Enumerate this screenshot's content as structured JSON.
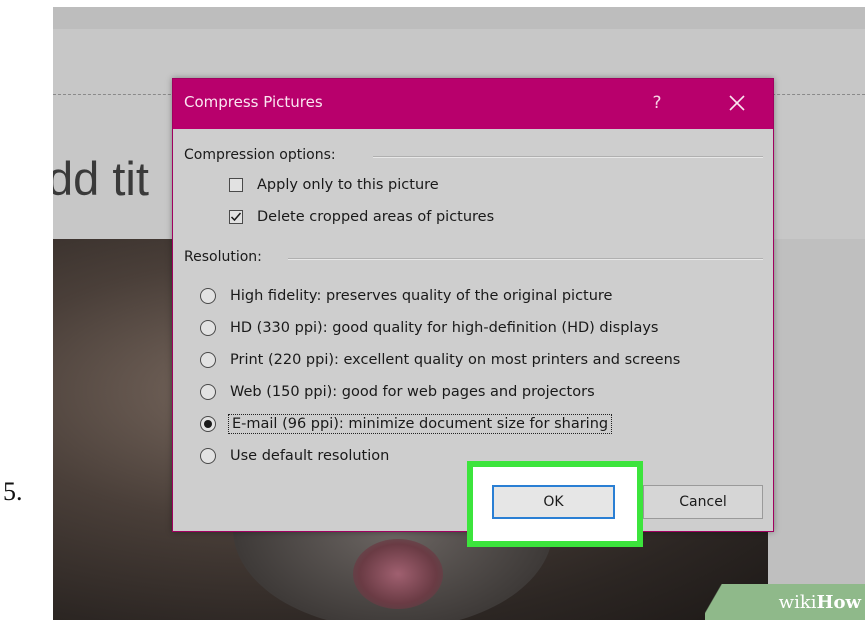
{
  "step_number": "5.",
  "slide": {
    "title_placeholder": "dd tit"
  },
  "watermark": {
    "prefix": "wiki",
    "brand": "How"
  },
  "dialog": {
    "title": "Compress Pictures",
    "help_label": "?",
    "titlebar_color": "#b8006c",
    "compression_group_label": "Compression options:",
    "checkboxes": [
      {
        "label": "Apply only to this picture",
        "checked": false
      },
      {
        "label": "Delete cropped areas of pictures",
        "checked": true
      }
    ],
    "resolution_group_label": "Resolution:",
    "radios": [
      {
        "label": "High fidelity: preserves quality of the original picture",
        "selected": false
      },
      {
        "label": "HD (330 ppi): good quality for high-definition (HD) displays",
        "selected": false
      },
      {
        "label": "Print (220 ppi): excellent quality on most printers and screens",
        "selected": false
      },
      {
        "label": "Web (150 ppi): good for web pages and projectors",
        "selected": false
      },
      {
        "label": "E-mail (96 ppi): minimize document size for sharing",
        "selected": true
      },
      {
        "label": "Use default resolution",
        "selected": false
      }
    ],
    "ok_label": "OK",
    "cancel_label": "Cancel",
    "highlight_color": "#3ce43c"
  }
}
